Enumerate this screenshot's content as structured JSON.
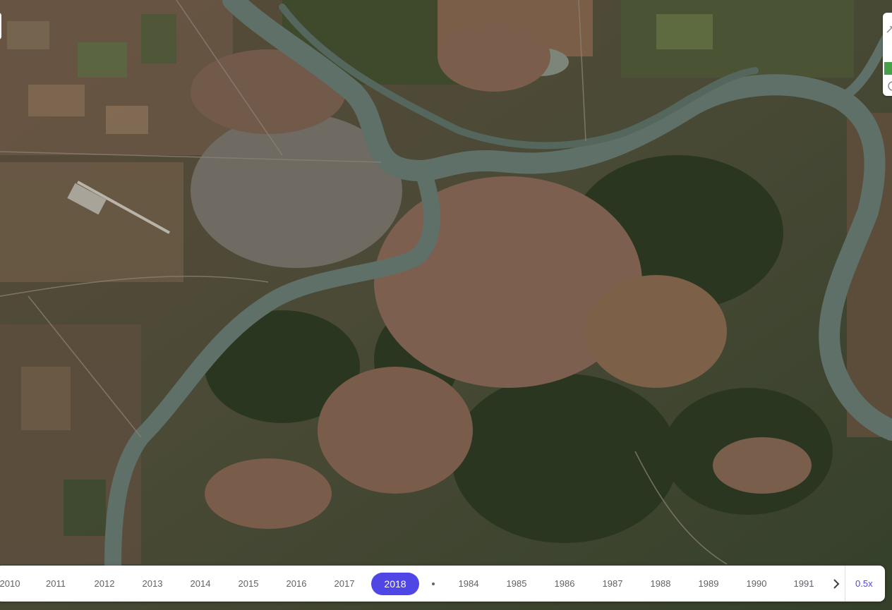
{
  "map": {
    "type": "satellite-timelapse",
    "colors": {
      "river": "#5f7068",
      "urban": "#8a6a56",
      "forest": "#2c3a22",
      "fields": "#6b5a44"
    }
  },
  "timeline": {
    "years_left": [
      "2010",
      "2011",
      "2012",
      "2013",
      "2014",
      "2015",
      "2016",
      "2017"
    ],
    "selected_year": "2018",
    "years_right": [
      "1984",
      "1985",
      "1986",
      "1987",
      "1988",
      "1989",
      "1990",
      "1991"
    ],
    "next_icon": "chevron-right-icon",
    "speed_label": "0.5x",
    "accent_color": "#4f46e5"
  },
  "controls": {
    "right_icons": [
      "expand-icon",
      "layers-icon",
      "settings-icon"
    ]
  }
}
